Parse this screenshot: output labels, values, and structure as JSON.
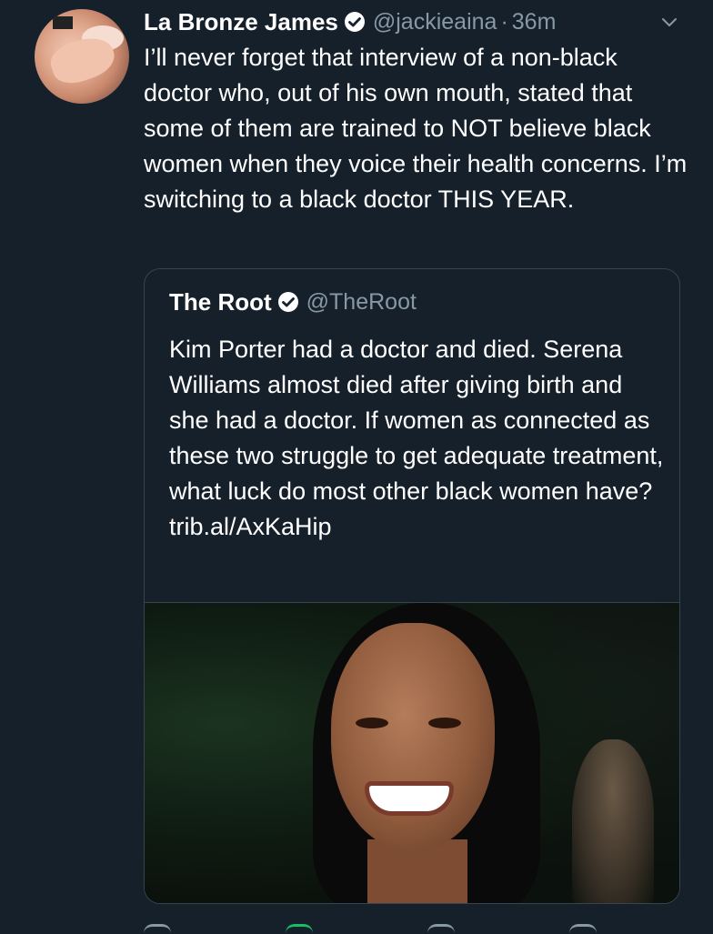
{
  "tweet": {
    "author_name": "La Bronze James",
    "author_handle": "@jackieaina",
    "separator": "·",
    "time": "36m",
    "text": "I’ll never forget that interview of a non-black doctor who, out of his own mouth, stated that some of them are trained to NOT believe black women when they voice their health concerns. I’m switching to a black doctor THIS YEAR."
  },
  "quoted": {
    "author_name": "The Root",
    "author_handle": "@TheRoot",
    "text": "Kim Porter had a doctor and died. Serena Williams almost died after giving birth and she had a doctor. If women as connected as these two struggle to get adequate treatment, what luck do most other black women have? trib.al/AxKaHip"
  },
  "icons": {
    "verified": "verified-badge-icon",
    "chevron": "chevron-down-icon",
    "reply": "reply-icon",
    "retweet": "retweet-icon",
    "like": "like-icon",
    "share": "share-icon"
  },
  "colors": {
    "background": "#15202b",
    "secondary_text": "#8899a6",
    "border": "#38444d",
    "retweet_green": "#17bf63"
  }
}
